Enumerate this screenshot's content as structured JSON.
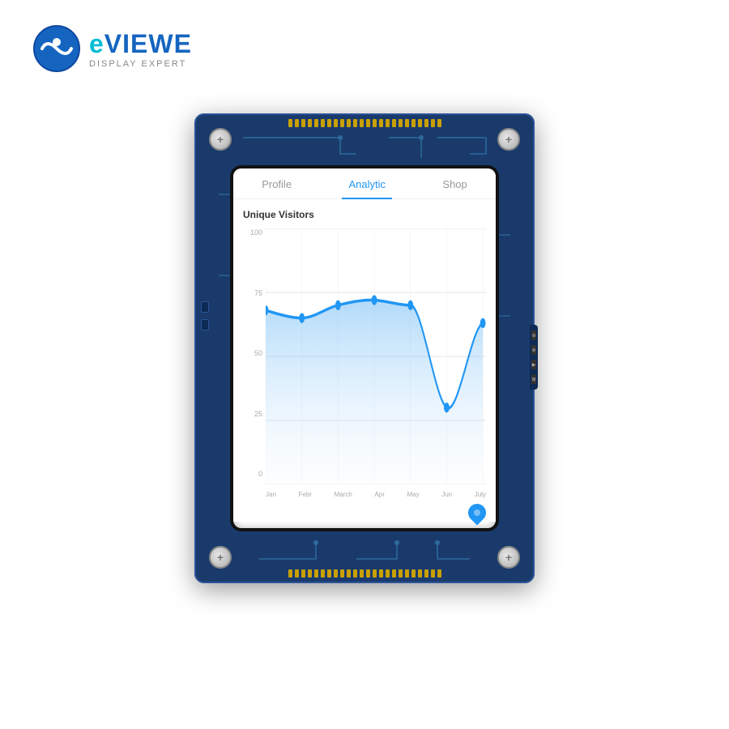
{
  "logo": {
    "brand_prefix": "e",
    "brand_name": "VIEWE",
    "tagline": "DISPLAY EXPERT"
  },
  "tabs": [
    {
      "label": "Profile",
      "active": false
    },
    {
      "label": "Analytic",
      "active": true
    },
    {
      "label": "Shop",
      "active": false
    }
  ],
  "chart": {
    "title": "Unique Visitors",
    "y_labels": [
      "100",
      "75",
      "50",
      "25",
      "0"
    ],
    "x_labels": [
      "Jan",
      "Febr",
      "March",
      "Apr",
      "May",
      "Jun",
      "July"
    ],
    "data_points": [
      68,
      65,
      70,
      72,
      70,
      30,
      63
    ]
  }
}
